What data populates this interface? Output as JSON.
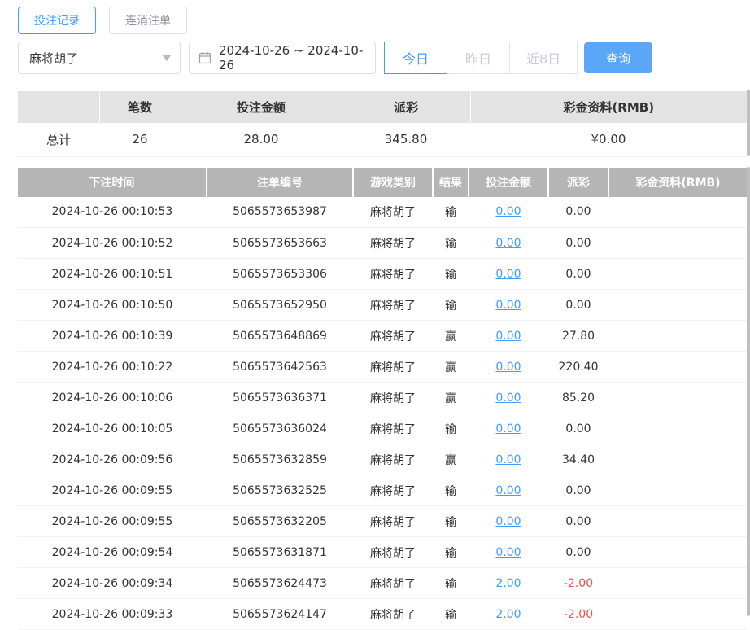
{
  "colors": {
    "accent": "#409eff",
    "query-btn": "#5ba7f7",
    "table-header": "#b5b5b5",
    "negative": "#f34b4b"
  },
  "tabs": {
    "bet_records": "投注记录",
    "cancelled_orders": "连消注单"
  },
  "filters": {
    "game_select_value": "麻将胡了",
    "date_range": "2024-10-26 ~ 2024-10-26",
    "today": "今日",
    "yesterday": "昨日",
    "last_8_days": "近8日",
    "query": "查询"
  },
  "summary": {
    "headers": [
      "",
      "笔数",
      "投注金额",
      "派彩",
      "彩金资料(RMB)"
    ],
    "row_label": "总计",
    "count": "26",
    "bet_amount": "28.00",
    "payout": "345.80",
    "bonus": "¥0.00"
  },
  "table": {
    "headers": [
      "下注时间",
      "注单编号",
      "游戏类别",
      "结果",
      "投注金额",
      "派彩",
      "彩金资料(RMB)"
    ],
    "rows": [
      {
        "time": "2024-10-26 00:10:53",
        "order": "5065573653987",
        "game": "麻将胡了",
        "result": "输",
        "bet": "0.00",
        "payout": "0.00",
        "bonus": ""
      },
      {
        "time": "2024-10-26 00:10:52",
        "order": "5065573653663",
        "game": "麻将胡了",
        "result": "输",
        "bet": "0.00",
        "payout": "0.00",
        "bonus": ""
      },
      {
        "time": "2024-10-26 00:10:51",
        "order": "5065573653306",
        "game": "麻将胡了",
        "result": "输",
        "bet": "0.00",
        "payout": "0.00",
        "bonus": ""
      },
      {
        "time": "2024-10-26 00:10:50",
        "order": "5065573652950",
        "game": "麻将胡了",
        "result": "输",
        "bet": "0.00",
        "payout": "0.00",
        "bonus": ""
      },
      {
        "time": "2024-10-26 00:10:39",
        "order": "5065573648869",
        "game": "麻将胡了",
        "result": "赢",
        "bet": "0.00",
        "payout": "27.80",
        "bonus": ""
      },
      {
        "time": "2024-10-26 00:10:22",
        "order": "5065573642563",
        "game": "麻将胡了",
        "result": "赢",
        "bet": "0.00",
        "payout": "220.40",
        "bonus": ""
      },
      {
        "time": "2024-10-26 00:10:06",
        "order": "5065573636371",
        "game": "麻将胡了",
        "result": "赢",
        "bet": "0.00",
        "payout": "85.20",
        "bonus": ""
      },
      {
        "time": "2024-10-26 00:10:05",
        "order": "5065573636024",
        "game": "麻将胡了",
        "result": "输",
        "bet": "0.00",
        "payout": "0.00",
        "bonus": ""
      },
      {
        "time": "2024-10-26 00:09:56",
        "order": "5065573632859",
        "game": "麻将胡了",
        "result": "赢",
        "bet": "0.00",
        "payout": "34.40",
        "bonus": ""
      },
      {
        "time": "2024-10-26 00:09:55",
        "order": "5065573632525",
        "game": "麻将胡了",
        "result": "输",
        "bet": "0.00",
        "payout": "0.00",
        "bonus": ""
      },
      {
        "time": "2024-10-26 00:09:55",
        "order": "5065573632205",
        "game": "麻将胡了",
        "result": "输",
        "bet": "0.00",
        "payout": "0.00",
        "bonus": ""
      },
      {
        "time": "2024-10-26 00:09:54",
        "order": "5065573631871",
        "game": "麻将胡了",
        "result": "输",
        "bet": "0.00",
        "payout": "0.00",
        "bonus": ""
      },
      {
        "time": "2024-10-26 00:09:34",
        "order": "5065573624473",
        "game": "麻将胡了",
        "result": "输",
        "bet": "2.00",
        "payout": "-2.00",
        "bonus": ""
      },
      {
        "time": "2024-10-26 00:09:33",
        "order": "5065573624147",
        "game": "麻将胡了",
        "result": "输",
        "bet": "2.00",
        "payout": "-2.00",
        "bonus": ""
      }
    ]
  }
}
